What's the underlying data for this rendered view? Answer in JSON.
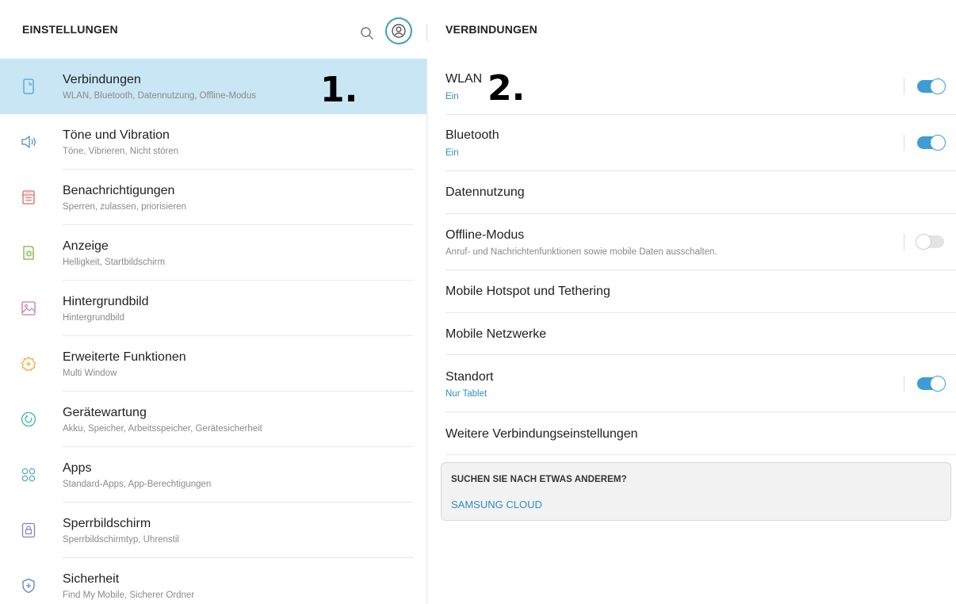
{
  "left": {
    "title": "EINSTELLUNGEN",
    "items": [
      {
        "title": "Verbindungen",
        "subtitle": "WLAN, Bluetooth, Datennutzung, Offline-Modus",
        "icon": "connections-icon"
      },
      {
        "title": "Töne und Vibration",
        "subtitle": "Töne, Vibrieren, Nicht stören",
        "icon": "speaker-icon"
      },
      {
        "title": "Benachrichtigungen",
        "subtitle": "Sperren, zulassen, priorisieren",
        "icon": "notifications-icon"
      },
      {
        "title": "Anzeige",
        "subtitle": "Helligkeit, Startbildschirm",
        "icon": "display-icon"
      },
      {
        "title": "Hintergrundbild",
        "subtitle": "Hintergrundbild",
        "icon": "wallpaper-icon"
      },
      {
        "title": "Erweiterte Funktionen",
        "subtitle": "Multi Window",
        "icon": "advanced-features-icon"
      },
      {
        "title": "Gerätewartung",
        "subtitle": "Akku, Speicher, Arbeitsspeicher, Gerätesicherheit",
        "icon": "device-care-icon"
      },
      {
        "title": "Apps",
        "subtitle": "Standard-Apps, App-Berechtigungen",
        "icon": "apps-icon"
      },
      {
        "title": "Sperrbildschirm",
        "subtitle": "Sperrbildschirmtyp, Uhrenstil",
        "icon": "lock-icon"
      },
      {
        "title": "Sicherheit",
        "subtitle": "Find My Mobile, Sicherer Ordner",
        "icon": "shield-icon"
      }
    ]
  },
  "right": {
    "title": "VERBINDUNGEN",
    "items": [
      {
        "title": "WLAN",
        "subtitle": "Ein",
        "toggle": true
      },
      {
        "title": "Bluetooth",
        "subtitle": "Ein",
        "toggle": true
      },
      {
        "title": "Datennutzung"
      },
      {
        "title": "Offline-Modus",
        "subtitle": "Anruf- und Nachrichtenfunktionen sowie mobile Daten ausschalten.",
        "toggle": false
      },
      {
        "title": "Mobile Hotspot und Tethering"
      },
      {
        "title": "Mobile Netzwerke"
      },
      {
        "title": "Standort",
        "subtitle": "Nur Tablet",
        "toggle": true
      },
      {
        "title": "Weitere Verbindungseinstellungen"
      }
    ],
    "suggest": {
      "title": "SUCHEN SIE NACH ETWAS ANDEREM?",
      "link": "SAMSUNG CLOUD"
    }
  },
  "annotations": {
    "one": "1.",
    "two": "2."
  },
  "colors": {
    "accent": "#3d9dd4",
    "active_bg": "#c9e6f5",
    "link": "#2f8ec6"
  }
}
